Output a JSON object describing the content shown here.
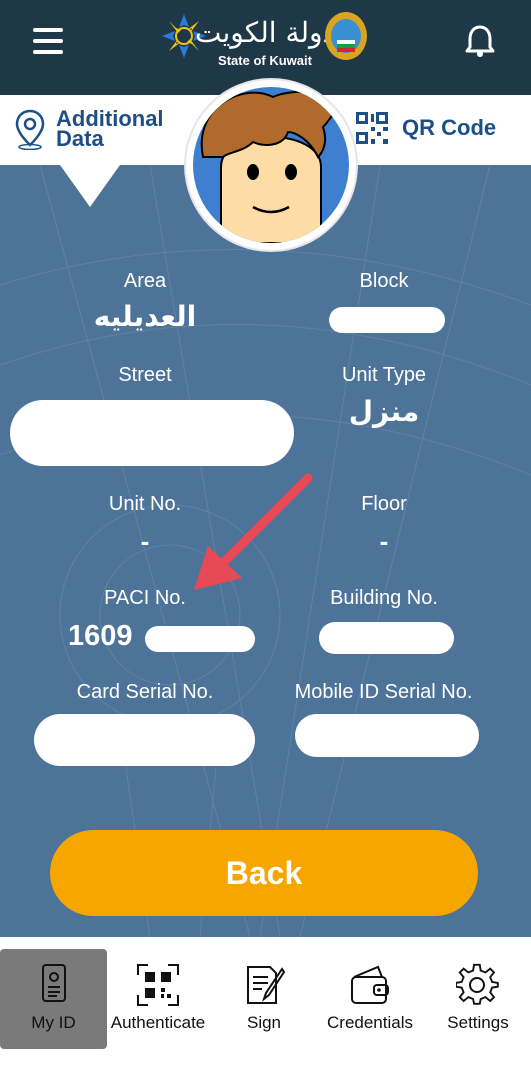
{
  "header": {
    "logo_caption": "State of Kuwait",
    "logo_arabic": "دولة الكويت"
  },
  "subbar": {
    "additional_data": [
      "Additional",
      "Data"
    ],
    "qr_code": "QR Code"
  },
  "fields": {
    "area": {
      "label": "Area",
      "value": "العديليه"
    },
    "block": {
      "label": "Block"
    },
    "street": {
      "label": "Street"
    },
    "unit_type": {
      "label": "Unit Type",
      "value": "منزل"
    },
    "unit_no": {
      "label": "Unit No.",
      "value": "-"
    },
    "floor": {
      "label": "Floor",
      "value": "-"
    },
    "paci_no": {
      "label": "PACI No.",
      "value": "1609"
    },
    "building_no": {
      "label": "Building No."
    },
    "card_serial": {
      "label": "Card Serial No."
    },
    "mobile_id_serial": {
      "label": "Mobile ID Serial No."
    }
  },
  "back_button": "Back",
  "tabs": [
    {
      "label": "My ID",
      "icon": "id-card-icon",
      "active": true
    },
    {
      "label": "Authenticate",
      "icon": "qr-scan-icon"
    },
    {
      "label": "Sign",
      "icon": "sign-document-icon"
    },
    {
      "label": "Credentials",
      "icon": "wallet-icon"
    },
    {
      "label": "Settings",
      "icon": "gear-icon"
    }
  ],
  "colors": {
    "header_bg": "#1f3847",
    "content_bg": "#4e7399",
    "accent_blue": "#1d4f86",
    "back_button": "#f7a600",
    "arrow": "#e84a55"
  }
}
